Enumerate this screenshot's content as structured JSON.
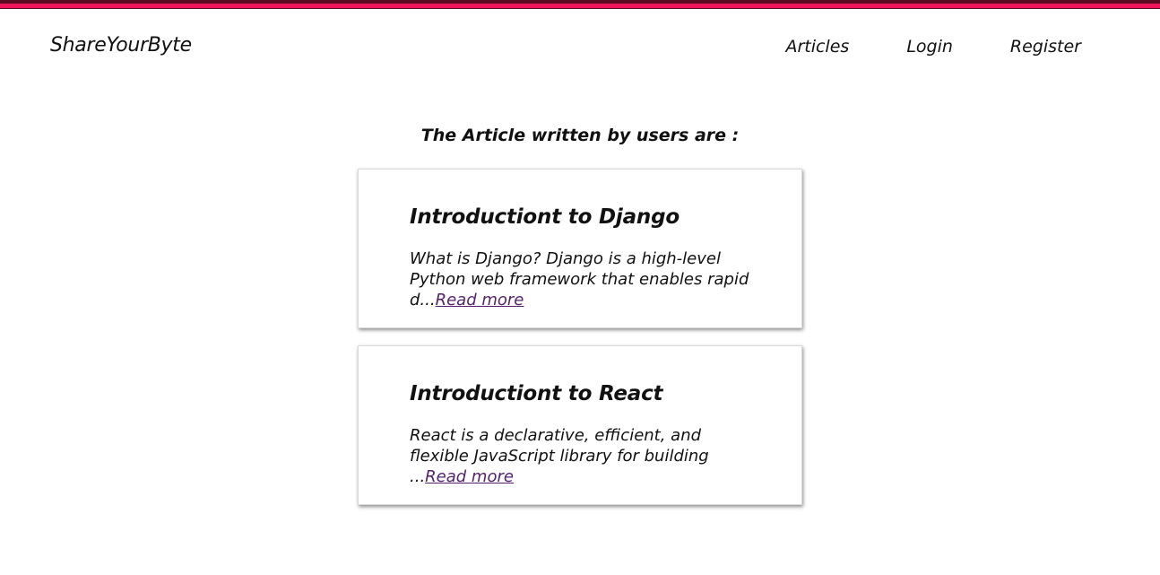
{
  "header": {
    "brand": "ShareYourByte",
    "nav": {
      "articles": "Articles",
      "login": "Login",
      "register": "Register"
    }
  },
  "main": {
    "heading": "The Article written by users are :",
    "articles": [
      {
        "title": "Introductiont to Django",
        "excerpt": "What is Django? Django is a high-level Python web framework that enables rapid d...",
        "read_more": "Read more"
      },
      {
        "title": "Introductiont to React",
        "excerpt": "React is a declarative, efficient, and flexible JavaScript library for building ...",
        "read_more": "Read more"
      }
    ]
  },
  "colors": {
    "accent_bar": "#f0145a",
    "accent_bar_dark": "#5a0a23",
    "link_visited": "#55236d"
  }
}
